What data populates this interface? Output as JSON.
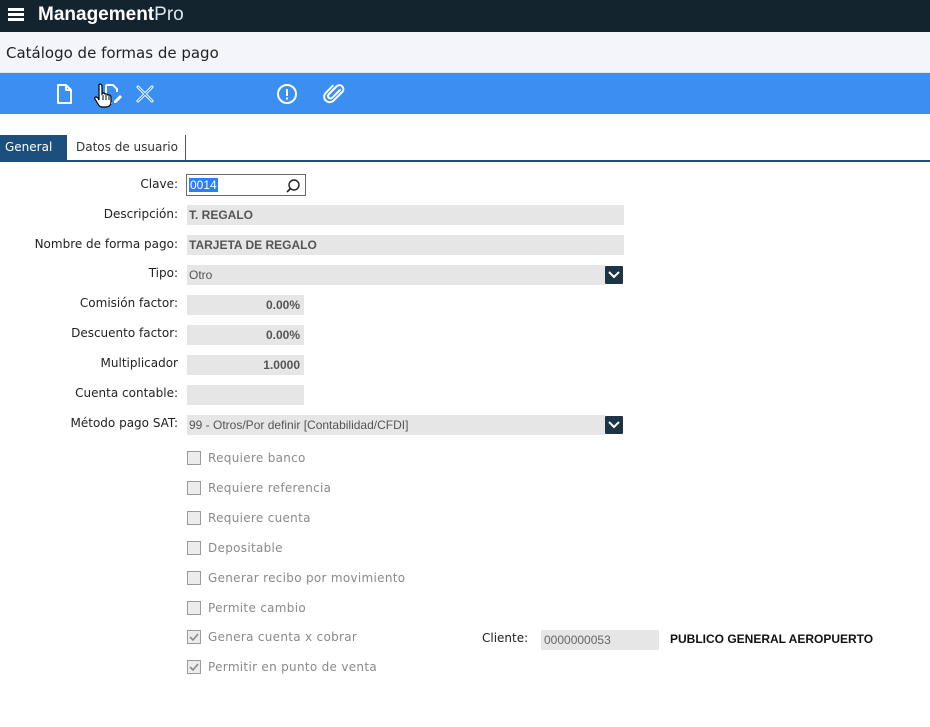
{
  "app": {
    "brand_bold": "Management",
    "brand_light": "Pro"
  },
  "page": {
    "title": "Catálogo de formas de pago"
  },
  "toolbar": {
    "buttons": [
      {
        "icon": "new-document-icon"
      },
      {
        "icon": "edit-icon"
      },
      {
        "icon": "delete-icon"
      },
      {
        "icon": "info-icon"
      },
      {
        "icon": "attach-icon"
      }
    ]
  },
  "tabs": [
    {
      "label": "General",
      "active": true
    },
    {
      "label": "Datos de usuario",
      "active": false
    }
  ],
  "form": {
    "clave": {
      "label": "Clave:",
      "value": "0014"
    },
    "descripcion": {
      "label": "Descripción:",
      "value": "T. REGALO"
    },
    "nombre": {
      "label": "Nombre de forma pago:",
      "value": "TARJETA DE REGALO"
    },
    "tipo": {
      "label": "Tipo:",
      "value": "Otro"
    },
    "comision": {
      "label": "Comisión factor:",
      "value": "0.00%"
    },
    "descuento": {
      "label": "Descuento factor:",
      "value": "0.00%"
    },
    "multiplicador": {
      "label": "Multiplicador",
      "value": "1.0000"
    },
    "cuenta": {
      "label": "Cuenta contable:",
      "value": ""
    },
    "metodo": {
      "label": "Método pago SAT:",
      "value": "99 - Otros/Por definir [Contabilidad/CFDI]"
    }
  },
  "checkboxes": [
    {
      "label": "Requiere banco",
      "checked": false
    },
    {
      "label": "Requiere referencia",
      "checked": false
    },
    {
      "label": "Requiere cuenta",
      "checked": false
    },
    {
      "label": "Depositable",
      "checked": false
    },
    {
      "label": "Generar recibo por movimiento",
      "checked": false
    },
    {
      "label": "Permite cambio",
      "checked": false
    },
    {
      "label": "Genera cuenta x cobrar",
      "checked": true
    },
    {
      "label": "Permitir en punto de venta",
      "checked": true
    }
  ],
  "cliente": {
    "label": "Cliente:",
    "code": "0000000053",
    "name": "PUBLICO GENERAL AEROPUERTO"
  },
  "colors": {
    "topbar": "#13242f",
    "toolbar": "#3b8ff2",
    "tab_active": "#1c4f7e"
  }
}
